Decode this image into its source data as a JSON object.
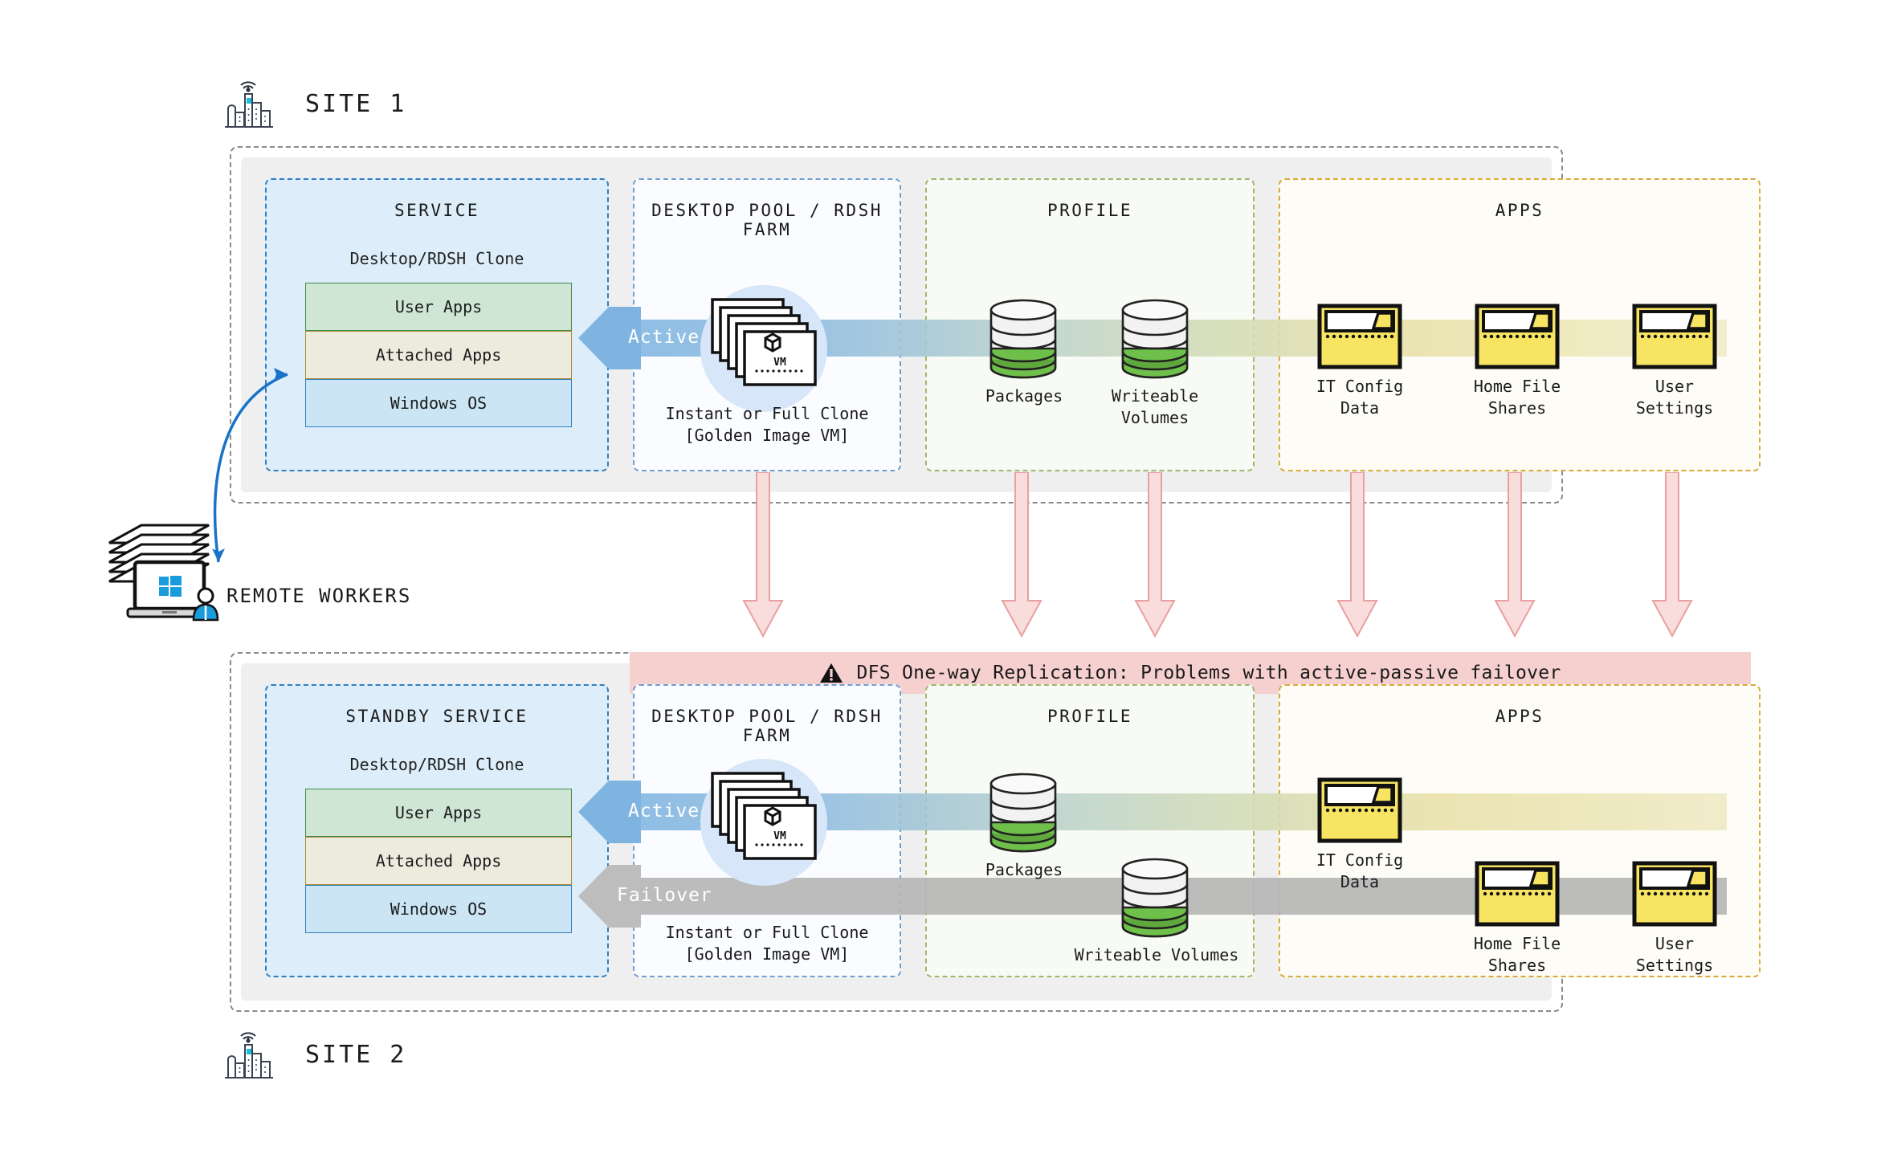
{
  "sites": {
    "site1": {
      "label": "SITE 1",
      "icon": "city-antenna-icon",
      "service": {
        "title": "SERVICE",
        "clone_caption": "Desktop/RDSH Clone",
        "layers": [
          {
            "label": "User Apps",
            "color": "#cfe6d5"
          },
          {
            "label": "Attached Apps",
            "color": "#edeade"
          },
          {
            "label": "Windows OS",
            "color": "#cbe5f5"
          }
        ]
      },
      "pool": {
        "title": "DESKTOP POOL / RDSH FARM",
        "icon": "vm-stack-icon",
        "caption_line1": "Instant or Full Clone",
        "caption_line2": "[Golden Image VM]"
      },
      "profile": {
        "title": "PROFILE",
        "items": [
          {
            "label": "Packages",
            "icon": "database-cylinder-icon"
          },
          {
            "label": "Writeable\nVolumes",
            "icon": "database-cylinder-icon"
          }
        ]
      },
      "apps": {
        "title": "APPS",
        "items": [
          {
            "label": "IT Config\nData",
            "icon": "folder-icon"
          },
          {
            "label": "Home File\nShares",
            "icon": "folder-icon"
          },
          {
            "label": "User\nSettings",
            "icon": "folder-icon"
          }
        ]
      },
      "flow": {
        "label": "Active",
        "color": "#7fb4e0"
      }
    },
    "site2": {
      "label": "SITE 2",
      "icon": "city-antenna-icon",
      "service": {
        "title": "STANDBY SERVICE",
        "clone_caption": "Desktop/RDSH Clone",
        "layers": [
          {
            "label": "User Apps",
            "color": "#cfe6d5"
          },
          {
            "label": "Attached Apps",
            "color": "#edeade"
          },
          {
            "label": "Windows OS",
            "color": "#cbe5f5"
          }
        ]
      },
      "pool": {
        "title": "DESKTOP POOL / RDSH FARM",
        "icon": "vm-stack-icon",
        "caption_line1": "Instant or Full Clone",
        "caption_line2": "[Golden Image VM]"
      },
      "profile": {
        "title": "PROFILE",
        "items": [
          {
            "label": "Packages",
            "icon": "database-cylinder-icon",
            "band": "active"
          },
          {
            "label": "Writeable Volumes",
            "icon": "database-cylinder-icon",
            "band": "failover"
          }
        ]
      },
      "apps": {
        "title": "APPS",
        "items": [
          {
            "label": "IT Config\nData",
            "icon": "folder-icon",
            "band": "active"
          },
          {
            "label": "Home File\nShares",
            "icon": "folder-icon",
            "band": "failover"
          },
          {
            "label": "User\nSettings",
            "icon": "folder-icon",
            "band": "failover"
          }
        ]
      },
      "flow_active": {
        "label": "Active",
        "color": "#7fb4e0"
      },
      "flow_failover": {
        "label": "Failover",
        "color": "#b5b5b5"
      }
    }
  },
  "replication": {
    "banner_text": "DFS One-way Replication: Problems with active-passive failover",
    "banner_icon": "warning-triangle-icon",
    "banner_color": "#f6cfcf",
    "arrow_color": "#f6d2d2",
    "arrow_count": 6
  },
  "remote_workers": {
    "label": "REMOTE WORKERS",
    "icon": "laptop-stack-windows-icon",
    "connector_icon": "curved-double-arrow-icon",
    "connector_color": "#1a73c8"
  },
  "colors": {
    "service_border": "#2f7fc1",
    "pool_border": "#6f9fd0",
    "profile_border": "#9db86a",
    "apps_border": "#d9a93a",
    "active_band": "#7fb4e0",
    "failover_band": "#b5b5b5",
    "folder_fill": "#f7e463",
    "db_green": "#6fc04a",
    "site_frame": "#8a8a8a"
  }
}
